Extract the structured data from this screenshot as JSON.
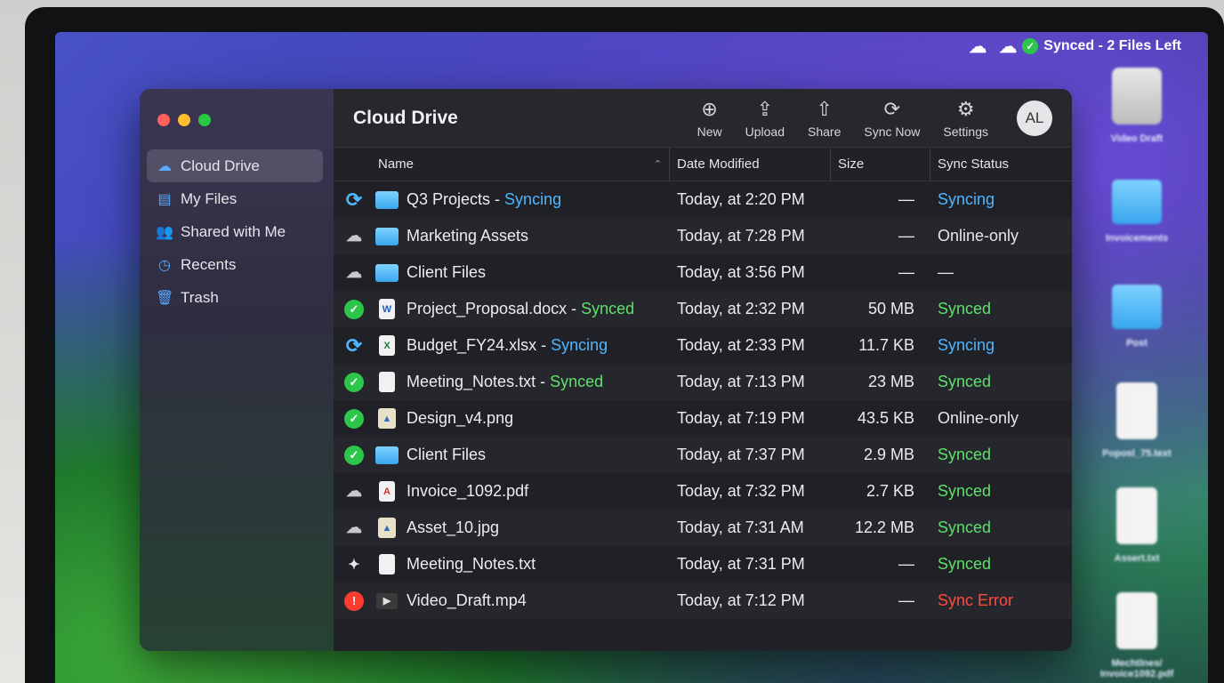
{
  "menubar": {
    "cloud_icon": "cloud-icon",
    "status_text": "Synced - 2 Files Left"
  },
  "window": {
    "title": "Cloud Drive",
    "traffic_lights": [
      "close",
      "minimize",
      "zoom"
    ]
  },
  "sidebar": {
    "items": [
      {
        "label": "Cloud Drive",
        "icon": "cloud-icon",
        "active": true
      },
      {
        "label": "My Files",
        "icon": "folder-icon",
        "active": false
      },
      {
        "label": "Shared with Me",
        "icon": "people-icon",
        "active": false
      },
      {
        "label": "Recents",
        "icon": "clock-icon",
        "active": false
      },
      {
        "label": "Trash",
        "icon": "trash-icon",
        "active": false
      }
    ]
  },
  "toolbar": {
    "new_label": "New",
    "upload_label": "Upload",
    "share_label": "Share",
    "sync_label": "Sync Now",
    "settings_label": "Settings",
    "avatar_initials": "AL"
  },
  "table": {
    "headers": {
      "name": "Name",
      "date": "Date Modified",
      "size": "Size",
      "status": "Sync Status"
    },
    "rows": [
      {
        "state": "syncing",
        "type": "folder",
        "name": "Q3 Projects",
        "tag": "Syncing",
        "date": "Today, at 2:20 PM",
        "size": "—",
        "status": "Syncing"
      },
      {
        "state": "cloud",
        "type": "folder",
        "name": "Marketing Assets",
        "tag": "",
        "date": "Today, at 7:28 PM",
        "size": "—",
        "status": "Online-only"
      },
      {
        "state": "cloud",
        "type": "folder",
        "name": "Client Files",
        "tag": "",
        "date": "Today, at 3:56 PM",
        "size": "—",
        "status": "—"
      },
      {
        "state": "synced",
        "type": "doc",
        "name": "Project_Proposal.docx",
        "tag": "Synced",
        "date": "Today, at 2:32 PM",
        "size": "50 MB",
        "status": "Synced"
      },
      {
        "state": "syncing",
        "type": "xls",
        "name": "Budget_FY24.xlsx",
        "tag": "Syncing",
        "date": "Today, at 2:33 PM",
        "size": "11.7 KB",
        "status": "Syncing"
      },
      {
        "state": "synced",
        "type": "txt",
        "name": "Meeting_Notes.txt",
        "tag": "Synced",
        "date": "Today, at 7:13 PM",
        "size": "23 MB",
        "status": "Synced"
      },
      {
        "state": "synced",
        "type": "img",
        "name": "Design_v4.png",
        "tag": "",
        "date": "Today, at 7:19 PM",
        "size": "43.5 KB",
        "status": "Online-only"
      },
      {
        "state": "synced",
        "type": "folder",
        "name": "Client Files",
        "tag": "",
        "date": "Today, at 7:37 PM",
        "size": "2.9 MB",
        "status": "Synced"
      },
      {
        "state": "cloud",
        "type": "pdf",
        "name": "Invoice_1092.pdf",
        "tag": "",
        "date": "Today, at 7:32 PM",
        "size": "2.7 KB",
        "status": "Synced"
      },
      {
        "state": "cloud",
        "type": "img",
        "name": "Asset_10.jpg",
        "tag": "",
        "date": "Today, at 7:31 AM",
        "size": "12.2 MB",
        "status": "Synced"
      },
      {
        "state": "pinned",
        "type": "txt",
        "name": "Meeting_Notes.txt",
        "tag": "",
        "date": "Today, at 7:31 PM",
        "size": "—",
        "status": "Synced"
      },
      {
        "state": "error",
        "type": "vid",
        "name": "Video_Draft.mp4",
        "tag": "",
        "date": "Today, at 7:12 PM",
        "size": "—",
        "status": "Sync Error"
      }
    ]
  },
  "desktop": {
    "items": [
      {
        "label": "Video Draft",
        "kind": "drive"
      },
      {
        "label": "Invoicements",
        "kind": "folder"
      },
      {
        "label": "Post",
        "kind": "folder"
      },
      {
        "label": "Poposl_75.text",
        "kind": "doc"
      },
      {
        "label": "Assert.txt",
        "kind": "doc"
      },
      {
        "label": "Mechtlnes/ Invoice1092.pdf",
        "kind": "doc"
      }
    ]
  },
  "colors": {
    "syncing": "#4fb6ff",
    "synced": "#5fe06a",
    "error": "#ff4b3e",
    "accent": "#5aa9ff"
  }
}
